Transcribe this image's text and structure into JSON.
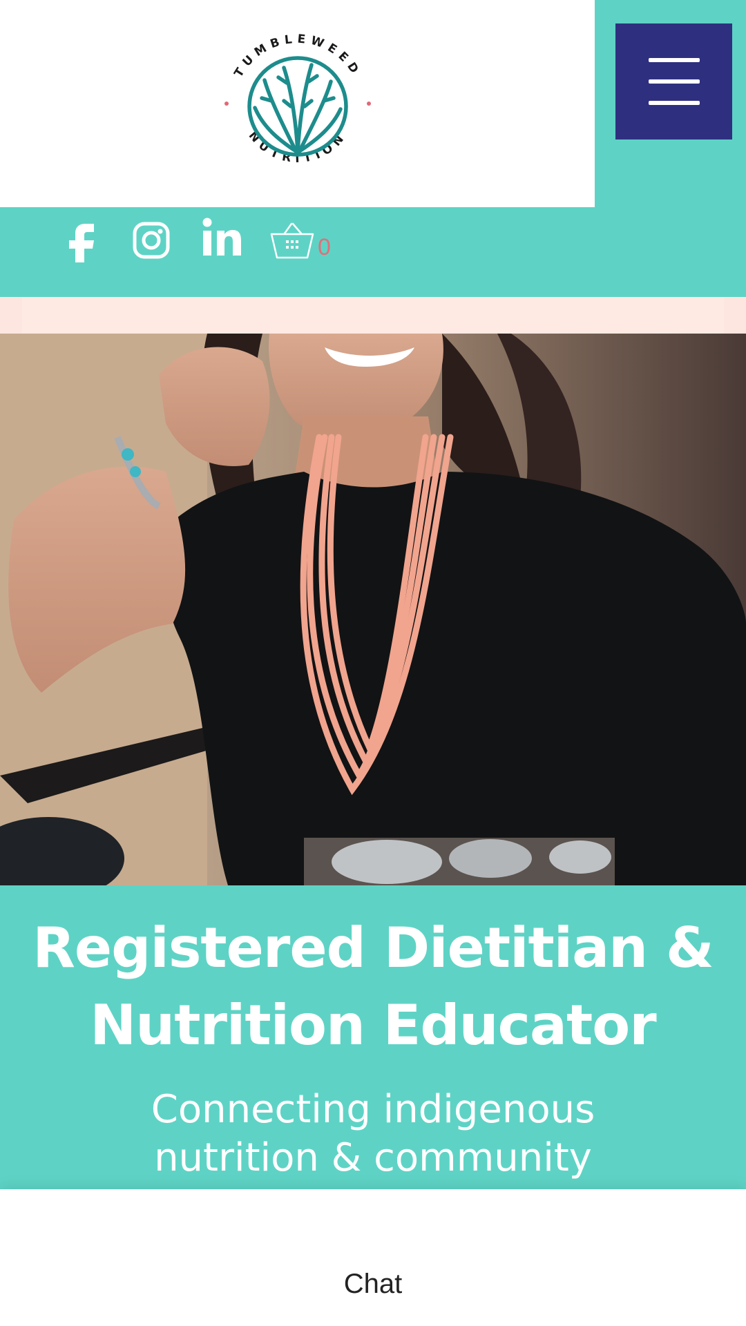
{
  "header": {
    "logo": {
      "top_text": "TUMBLEWEED",
      "bottom_text": "NUTRITION",
      "color": "#1d8c8c"
    },
    "menu_icon": "hamburger-menu-icon",
    "menu_color": "#2f2f80"
  },
  "social": {
    "icons": [
      "facebook-icon",
      "instagram-icon",
      "linkedin-icon"
    ],
    "cart_icon": "shopping-basket-icon",
    "cart_count": "0"
  },
  "hero": {
    "headline_line1": "Registered Dietitian &",
    "headline_line2": "Nutrition Educator",
    "subhead_line1": "Connecting indigenous",
    "subhead_line2": "nutrition & community"
  },
  "chat": {
    "label": "Chat"
  },
  "colors": {
    "teal": "#5ed3c5",
    "navy": "#2f2f80",
    "pink": "#fde6df",
    "cart_count": "#e0707a"
  }
}
